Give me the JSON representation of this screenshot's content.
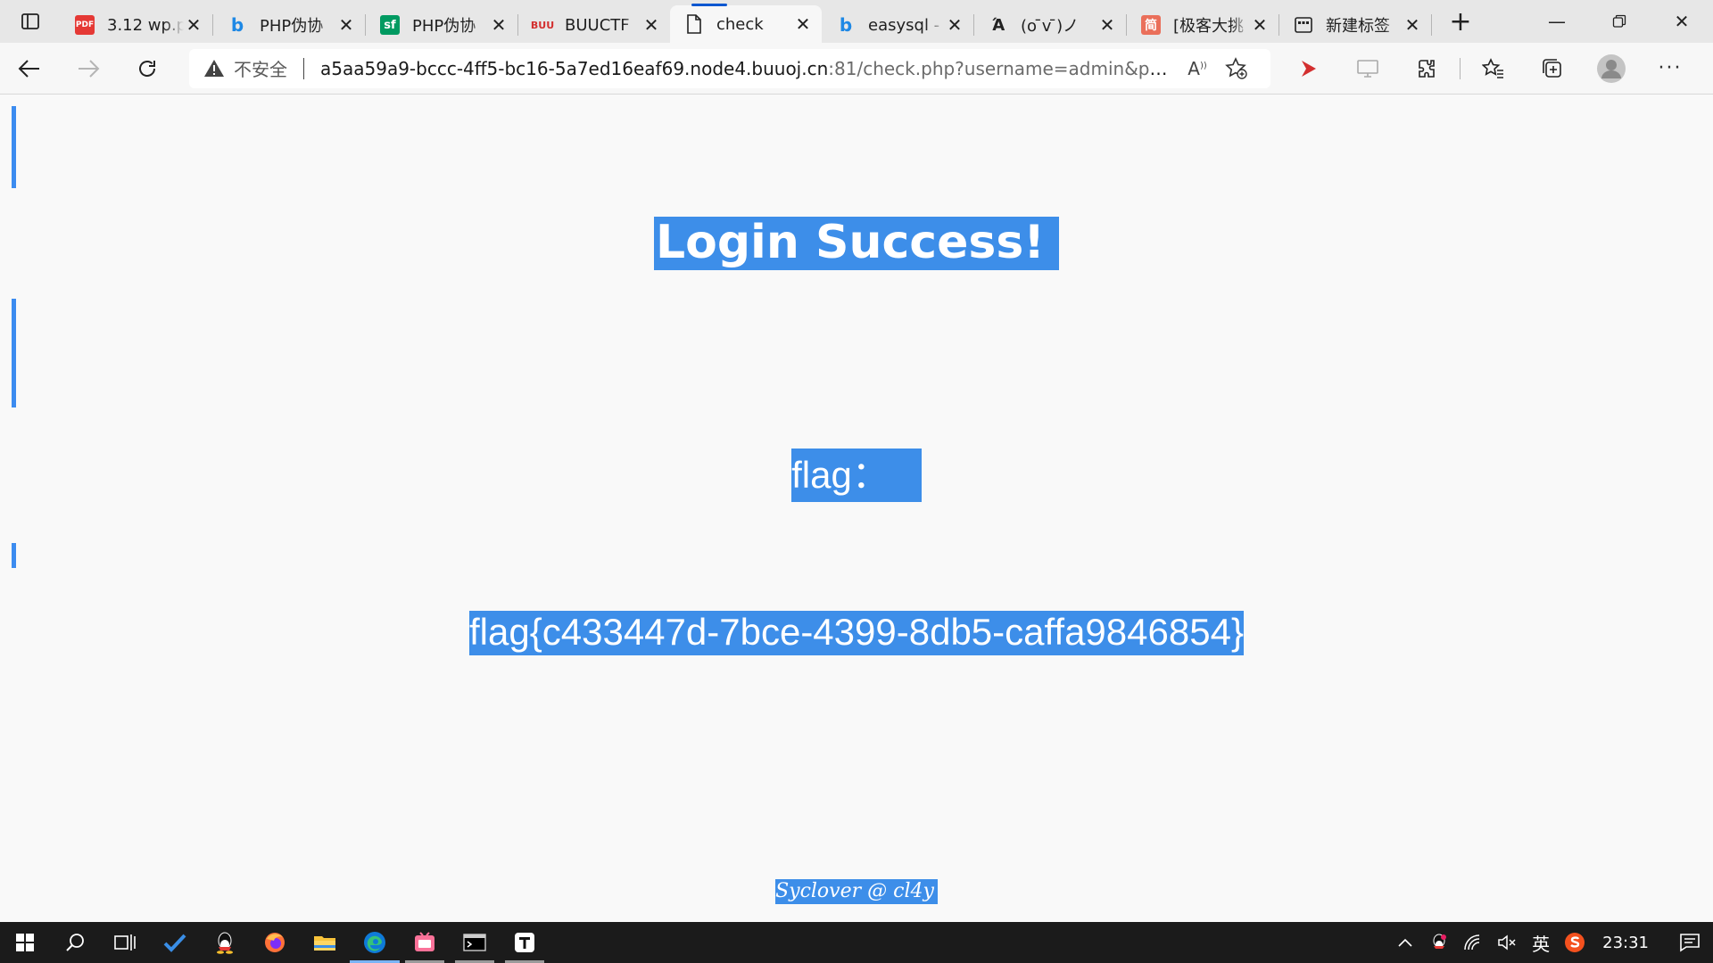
{
  "browser": {
    "tabs": [
      {
        "title": "3.12 wp.p",
        "favicon": "pdf-icon",
        "active": false
      },
      {
        "title": "PHP伪协",
        "favicon": "bing-icon",
        "active": false
      },
      {
        "title": "PHP伪协",
        "favicon": "segmentfault-icon",
        "active": false
      },
      {
        "title": "BUUCTF",
        "favicon": "buuctf-icon",
        "active": false
      },
      {
        "title": "check",
        "favicon": "page-icon",
        "active": true
      },
      {
        "title": "easysql -",
        "favicon": "bing-icon",
        "active": false
      },
      {
        "title": "(o ̄v ̄)ノ",
        "favicon": "translate-icon",
        "active": false
      },
      {
        "title": "[极客大挑",
        "favicon": "jianshu-icon",
        "active": false
      },
      {
        "title": "新建标签",
        "favicon": "newtab-page-icon",
        "active": false
      }
    ],
    "address": {
      "security_label": "不安全",
      "url_host": "a5aa59a9-bccc-4ff5-bc16-5a7ed16eaf69.node4.buuoj.cn",
      "url_rest": ":81/check.php?username=admin&passwor..."
    }
  },
  "page": {
    "title": "Login Success!",
    "flag_label": "flag：",
    "flag_value": "flag{c433447d-7bce-4399-8db5-caffa9846854}",
    "footer": "Syclover @ cl4y",
    "selection_color": "#3d8ee9"
  },
  "taskbar": {
    "clock": "23:31",
    "ime_label": "英",
    "apps": [
      "windows-start-icon",
      "search-icon",
      "task-view-icon",
      "todo-icon",
      "qq-icon",
      "firefox-icon",
      "file-explorer-icon",
      "edge-icon",
      "bilibili-icon",
      "terminal-icon",
      "typora-icon"
    ]
  }
}
